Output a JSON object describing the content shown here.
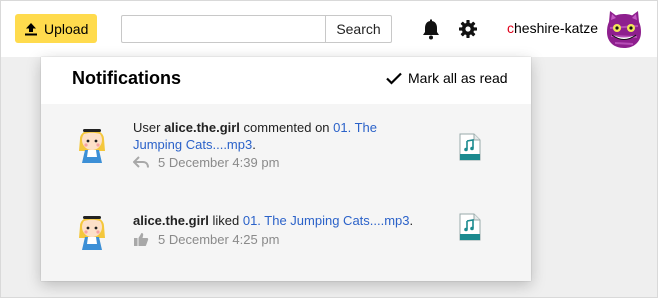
{
  "header": {
    "upload_label": "Upload",
    "search_placeholder": "",
    "search_label": "Search",
    "username_first": "c",
    "username_rest": "heshire-katze"
  },
  "notifications": {
    "title": "Notifications",
    "mark_all_label": "Mark all as read",
    "items": [
      {
        "prefix": "User ",
        "user": "alice.the.girl",
        "action": " commented on ",
        "target": "01. The Jumping Cats....mp3",
        "suffix": ".",
        "time": "5 December 4:39 pm",
        "type_icon": "reply-icon"
      },
      {
        "prefix": "",
        "user": "alice.the.girl",
        "action": " liked ",
        "target": "01. The Jumping Cats....mp3",
        "suffix": ".",
        "time": "5 December 4:25 pm",
        "type_icon": "thumbs-up-icon"
      }
    ]
  },
  "colors": {
    "upload_yellow": "#ffdb4d",
    "link_blue": "#2b62c9",
    "username_accent": "#e0001a",
    "file_icon_teal": "#1b8a8f"
  }
}
